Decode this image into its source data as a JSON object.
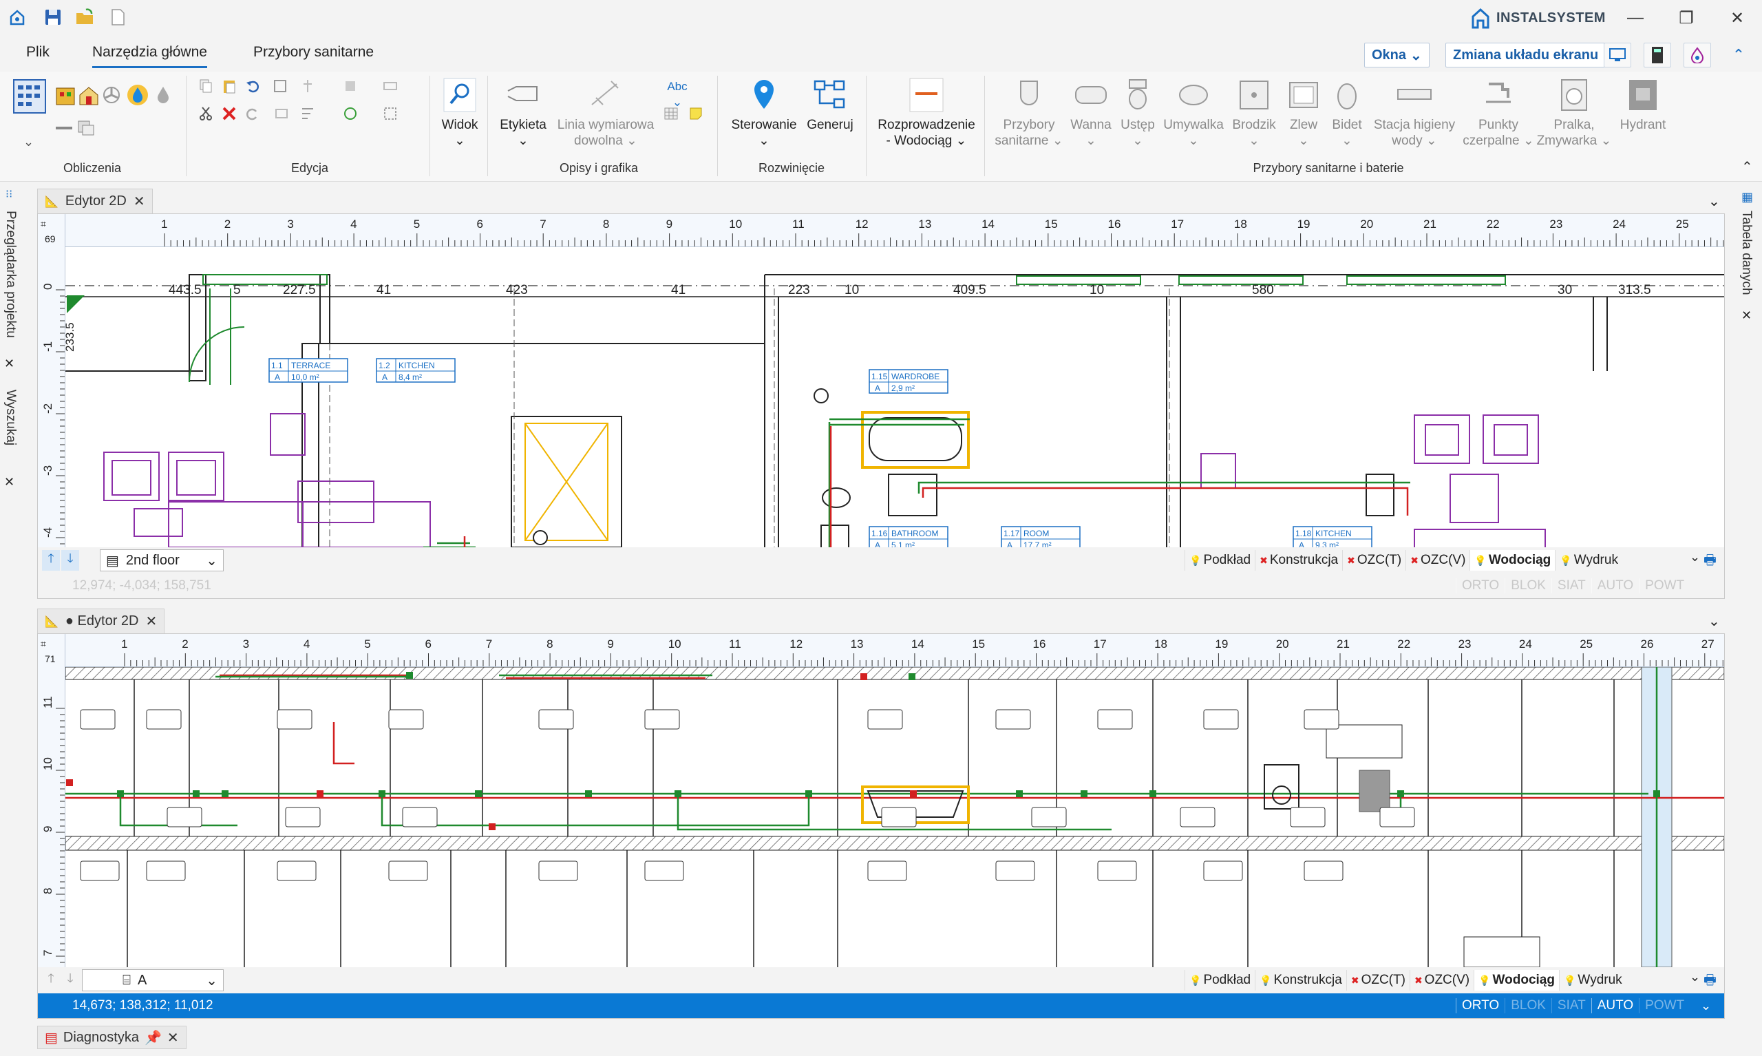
{
  "brand": {
    "name": "INSTALSYSTEM"
  },
  "window_controls": {
    "minimize": "—",
    "maximize": "❐",
    "close": "✕"
  },
  "menu": {
    "tabs": [
      {
        "label": "Plik",
        "active": false
      },
      {
        "label": "Narzędzia główne",
        "active": true
      },
      {
        "label": "Przybory sanitarne",
        "active": false
      }
    ],
    "okna": "Okna",
    "layout": "Zmiana układu ekranu"
  },
  "ribbon": {
    "groups": {
      "obliczenia": "Obliczenia",
      "edycja": "Edycja",
      "opisy": "Opisy i grafika",
      "rozwiniecie": "Rozwinięcie",
      "przybory": "Przybory sanitarne i baterie"
    },
    "widok": "Widok",
    "etykieta": "Etykieta",
    "linia": [
      "Linia wymiarowa",
      "dowolna"
    ],
    "abc": "Abc",
    "sterowanie": "Sterowanie",
    "generuj": "Generuj",
    "rozprowadzenie": [
      "Rozprowadzenie",
      "- Wodociąg"
    ],
    "fixtures": [
      {
        "l1": "Przybory",
        "l2": "sanitarne"
      },
      {
        "l1": "Wanna",
        "l2": ""
      },
      {
        "l1": "Ustęp",
        "l2": ""
      },
      {
        "l1": "Umywalka",
        "l2": ""
      },
      {
        "l1": "Brodzik",
        "l2": ""
      },
      {
        "l1": "Zlew",
        "l2": ""
      },
      {
        "l1": "Bidet",
        "l2": ""
      },
      {
        "l1": "Stacja higieny",
        "l2": "wody"
      },
      {
        "l1": "Punkty",
        "l2": "czerpalne"
      },
      {
        "l1": "Pralka,",
        "l2": "Zmywarka"
      },
      {
        "l1": "Hydrant",
        "l2": ""
      }
    ]
  },
  "side": {
    "left_top": "Przeglądarka projektu",
    "left_bottom": "Wyszukaj",
    "right": "Tabela danych"
  },
  "editor1": {
    "tab": "Edytor 2D",
    "ruler_corner": "69",
    "floor": "2nd floor",
    "coords": "12,974; -4,034; 158,751",
    "dims": [
      "443.5",
      "5",
      "227.5",
      "41",
      "423",
      "41",
      "223",
      "10",
      "409.5",
      "10",
      "580",
      "30",
      "313.5"
    ],
    "vdim": "233.5",
    "rooms": [
      {
        "id": "1.1",
        "name": "TERRACE",
        "area": "10,0 m²"
      },
      {
        "id": "1.2",
        "name": "KITCHEN",
        "area": "8,4 m²"
      },
      {
        "id": "1.15",
        "name": "WARDROBE",
        "area": "2,9 m²"
      },
      {
        "id": "1.16",
        "name": "BATHROOM",
        "area": "5,1 m²"
      },
      {
        "id": "1.17",
        "name": "ROOM",
        "area": "17,7 m²"
      },
      {
        "id": "1.18",
        "name": "KITCHEN",
        "area": "9,3 m²"
      }
    ]
  },
  "editor2": {
    "tab": "● Edytor 2D",
    "ruler_corner": "71",
    "view": "A",
    "coords": "14,673; 138,312; 11,012"
  },
  "layers": [
    "Podkład",
    "Konstrukcja",
    "OZC(T)",
    "OZC(V)",
    "Wodociąg",
    "Wydruk"
  ],
  "status_flags": [
    "ORTO",
    "BLOK",
    "SIAT",
    "AUTO",
    "POWT"
  ],
  "diagnostics": "Diagnostyka",
  "colors": {
    "accent": "#1a6fc4",
    "statusbar": "#0a79d4",
    "wall": "#222222",
    "pipe_green": "#1f8a2e",
    "pipe_red": "#d22020",
    "furniture": "#8b2fa8",
    "highlight": "#f0b400"
  }
}
